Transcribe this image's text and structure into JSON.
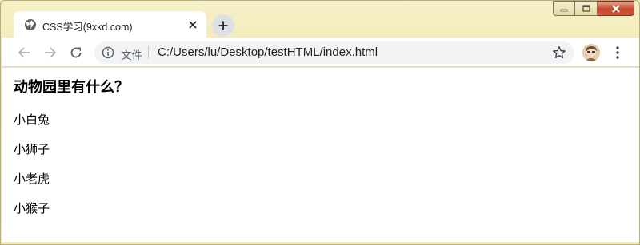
{
  "tab": {
    "title": "CSS学习(9xkd.com)"
  },
  "omnibox": {
    "scheme_label": "文件",
    "url": "C:/Users/lu/Desktop/testHTML/index.html"
  },
  "page": {
    "heading": "动物园里有什么？",
    "items": [
      "小白兔",
      "小狮子",
      "小老虎",
      "小猴子"
    ]
  }
}
